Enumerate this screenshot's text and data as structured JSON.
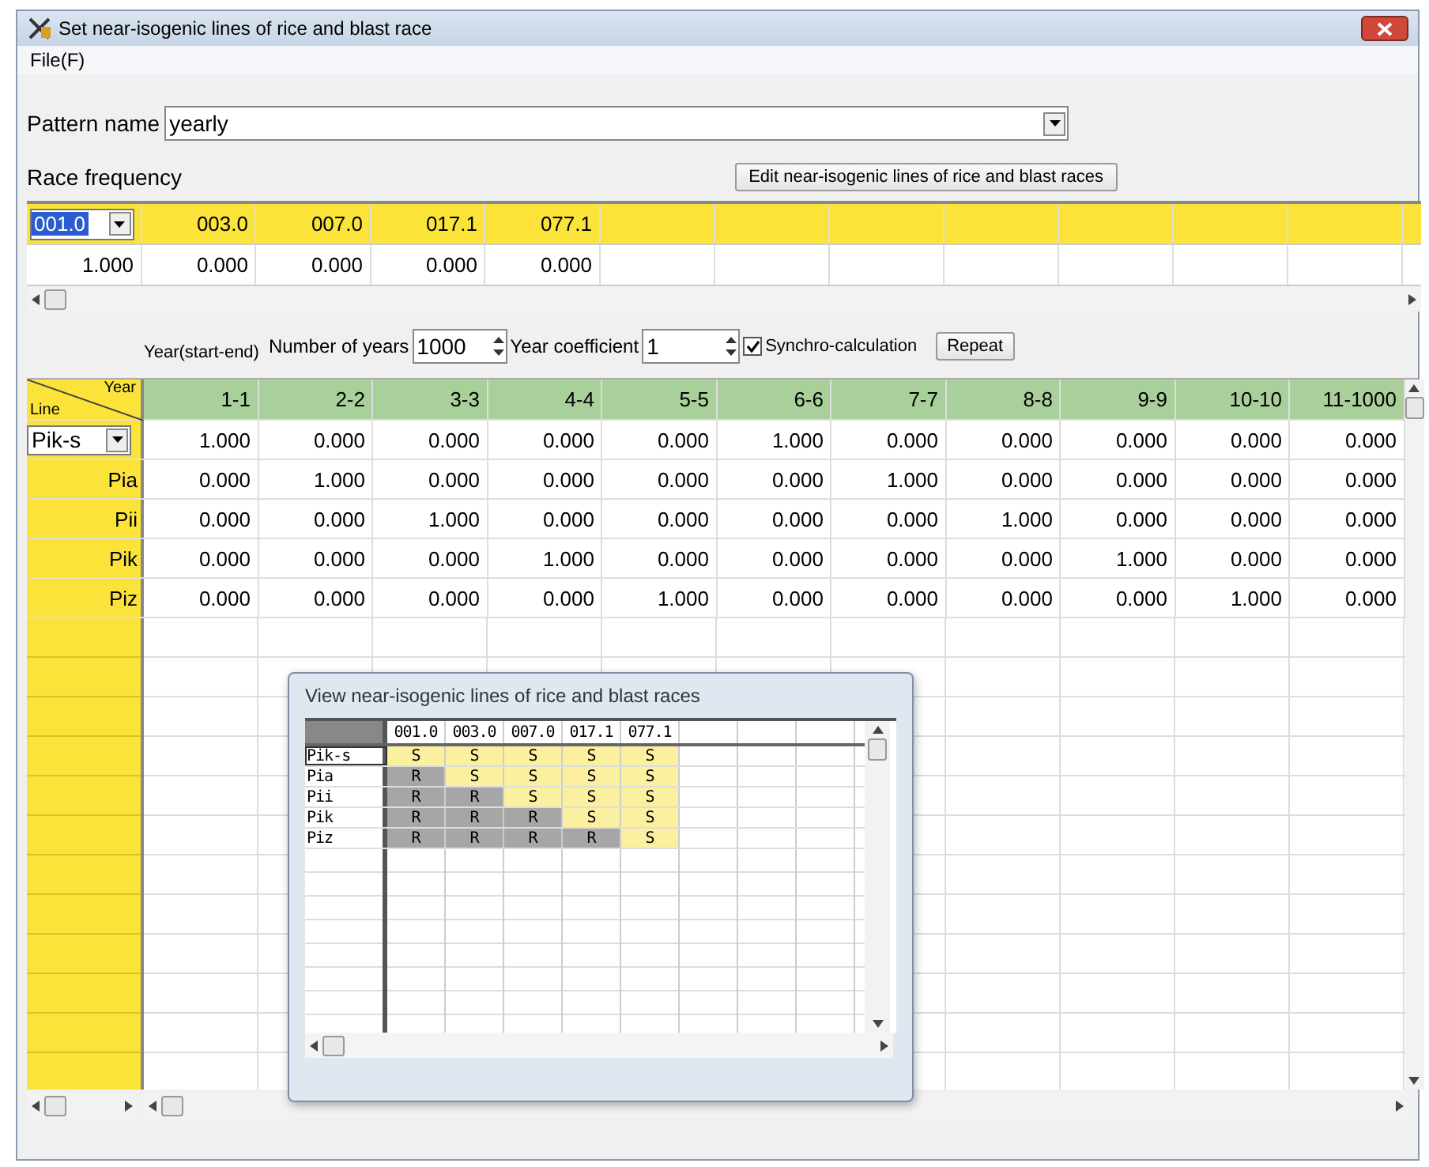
{
  "window": {
    "title": "Set near-isogenic lines of rice and blast race"
  },
  "menu": [
    "File(F)"
  ],
  "pattern": {
    "label": "Pattern name",
    "value": "yearly"
  },
  "race_frequency": {
    "label": "Race frequency",
    "edit_button": "Edit near-isogenic lines of rice and blast races",
    "races": [
      "001.0",
      "003.0",
      "007.0",
      "017.1",
      "077.1"
    ],
    "frequencies": [
      "1.000",
      "0.000",
      "0.000",
      "0.000",
      "0.000"
    ]
  },
  "controls": {
    "range_label": "Year(start-end)",
    "years_label": "Number of years",
    "years_value": "1000",
    "coefficient_label": "Year coefficient",
    "coefficient_value": "1",
    "synchro": {
      "label": "Synchro-calculation",
      "checked": true
    },
    "repeat_button": "Repeat"
  },
  "main_table": {
    "year_header": "Year",
    "line_header": "Line",
    "columns": [
      "1-1",
      "2-2",
      "3-3",
      "4-4",
      "5-5",
      "6-6",
      "7-7",
      "8-8",
      "9-9",
      "10-10",
      "11-1000"
    ],
    "rows": [
      {
        "line": "Pik-s",
        "values": [
          "1.000",
          "0.000",
          "0.000",
          "0.000",
          "0.000",
          "1.000",
          "0.000",
          "0.000",
          "0.000",
          "0.000",
          "0.000"
        ]
      },
      {
        "line": "Pia",
        "values": [
          "0.000",
          "1.000",
          "0.000",
          "0.000",
          "0.000",
          "0.000",
          "1.000",
          "0.000",
          "0.000",
          "0.000",
          "0.000"
        ]
      },
      {
        "line": "Pii",
        "values": [
          "0.000",
          "0.000",
          "1.000",
          "0.000",
          "0.000",
          "0.000",
          "0.000",
          "1.000",
          "0.000",
          "0.000",
          "0.000"
        ]
      },
      {
        "line": "Pik",
        "values": [
          "0.000",
          "0.000",
          "0.000",
          "1.000",
          "0.000",
          "0.000",
          "0.000",
          "0.000",
          "1.000",
          "0.000",
          "0.000"
        ]
      },
      {
        "line": "Piz",
        "values": [
          "0.000",
          "0.000",
          "0.000",
          "0.000",
          "1.000",
          "0.000",
          "0.000",
          "0.000",
          "0.000",
          "1.000",
          "0.000"
        ]
      }
    ]
  },
  "view_window": {
    "title": "View near-isogenic lines of rice and blast races",
    "columns": [
      "001.0",
      "003.0",
      "007.0",
      "017.1",
      "077.1"
    ],
    "rows": [
      {
        "line": "Pik-s",
        "cells": [
          {
            "value": "S",
            "kind": "susceptible"
          },
          {
            "value": "S",
            "kind": "susceptible"
          },
          {
            "value": "S",
            "kind": "susceptible"
          },
          {
            "value": "S",
            "kind": "susceptible"
          },
          {
            "value": "S",
            "kind": "susceptible"
          }
        ]
      },
      {
        "line": "Pia",
        "cells": [
          {
            "value": "R",
            "kind": "resistant"
          },
          {
            "value": "S",
            "kind": "susceptible"
          },
          {
            "value": "S",
            "kind": "susceptible"
          },
          {
            "value": "S",
            "kind": "susceptible"
          },
          {
            "value": "S",
            "kind": "susceptible"
          }
        ]
      },
      {
        "line": "Pii",
        "cells": [
          {
            "value": "R",
            "kind": "resistant"
          },
          {
            "value": "R",
            "kind": "resistant"
          },
          {
            "value": "S",
            "kind": "susceptible"
          },
          {
            "value": "S",
            "kind": "susceptible"
          },
          {
            "value": "S",
            "kind": "susceptible"
          }
        ]
      },
      {
        "line": "Pik",
        "cells": [
          {
            "value": "R",
            "kind": "resistant"
          },
          {
            "value": "R",
            "kind": "resistant"
          },
          {
            "value": "R",
            "kind": "resistant"
          },
          {
            "value": "S",
            "kind": "susceptible"
          },
          {
            "value": "S",
            "kind": "susceptible"
          }
        ]
      },
      {
        "line": "Piz",
        "cells": [
          {
            "value": "R",
            "kind": "resistant"
          },
          {
            "value": "R",
            "kind": "resistant"
          },
          {
            "value": "R",
            "kind": "resistant"
          },
          {
            "value": "R",
            "kind": "resistant"
          },
          {
            "value": "S",
            "kind": "susceptible"
          }
        ]
      }
    ]
  }
}
